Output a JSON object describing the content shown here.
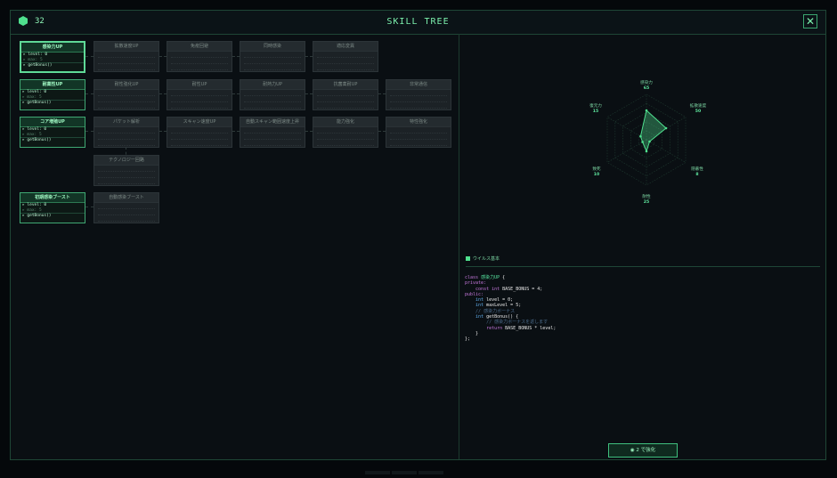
{
  "header": {
    "coins": "32",
    "title": "SKILL TREE",
    "close_icon": "close-icon",
    "coin_icon": "hex-coin-icon"
  },
  "colors": {
    "accent": "#4fe08e",
    "panel": "#0a0f13",
    "border": "#1f4636"
  },
  "tree": {
    "active_nodes": [
      {
        "title": "感染力UP",
        "level": "level: 0",
        "max": "max: 5",
        "fn": "getBonus()"
      },
      {
        "title": "耐薬性UP",
        "level": "level: 0",
        "max": "max: 5",
        "fn": "getBonus()"
      },
      {
        "title": "コア増殖UP",
        "level": "level: 0",
        "max": "max: 5",
        "fn": "getBonus()"
      },
      {
        "title": "初期感染ブースト",
        "level": "level: 0",
        "max": "max: 5",
        "fn": "getBonus()"
      }
    ],
    "locked_nodes": [
      "拡散速度UP",
      "免疫回避",
      "同時感染",
      "適応変異",
      "耐性強化UP",
      "耐性UP",
      "耐熱力UP",
      "抗菌薬耐UP",
      "非常通信",
      "パケット解析",
      "スキャン速度UP",
      "自動スキャン範囲速度上昇",
      "能力強化",
      "特性強化",
      "テクノロジー回路",
      "自動感染ブースト"
    ]
  },
  "radar": {
    "axes": [
      {
        "label": "感染力",
        "value": "65"
      },
      {
        "label": "拡散速度",
        "value": "50"
      },
      {
        "label": "隠蔽性",
        "value": "8"
      },
      {
        "label": "耐性",
        "value": "25"
      },
      {
        "label": "致死",
        "value": "10"
      },
      {
        "label": "復元力",
        "value": "15"
      }
    ],
    "legend": "ウイルス基本"
  },
  "code": {
    "l1a": "class ",
    "l1b": "感染力UP",
    "l1c": " {",
    "l2": "private:",
    "l3a": "    const int ",
    "l3b": "BASE_BONUS = 4;",
    "l4": "public:",
    "l5a": "    int ",
    "l5b": "level = 0;",
    "l6a": "    int ",
    "l6b": "maxLevel = 5;",
    "l7": "    // 感染力ボーナス",
    "l8a": "    int ",
    "l8b": "getBonus() {",
    "l9": "        // 感染力ボーナスを返します",
    "l10a": "        return ",
    "l10b": "BASE_BONUS * level;",
    "l11": "    }",
    "l12": "};"
  },
  "upgrade": {
    "label": "◉ 2  で強化"
  }
}
